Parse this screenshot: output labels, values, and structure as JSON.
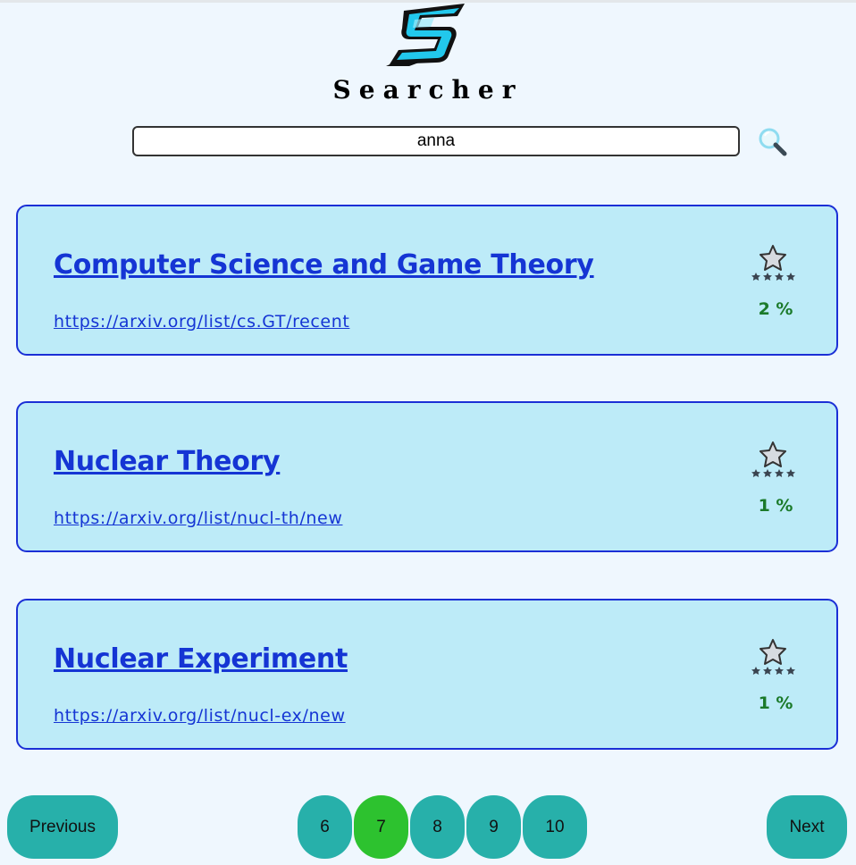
{
  "header": {
    "brand": "Searcher",
    "logo_icon": "lightning-s-logo",
    "accent_color": "#1fd0f0"
  },
  "search": {
    "value": "anna",
    "button_icon": "magnifier-icon"
  },
  "results": [
    {
      "title": "Computer Science and Game Theory",
      "url": "https://arxiv.org/list/cs.GT/recent",
      "score": "2 %"
    },
    {
      "title": "Nuclear Theory",
      "url": "https://arxiv.org/list/nucl-th/new",
      "score": "1 %"
    },
    {
      "title": "Nuclear Experiment",
      "url": "https://arxiv.org/list/nucl-ex/new",
      "score": "1 %"
    }
  ],
  "pagination": {
    "previous_label": "Previous",
    "next_label": "Next",
    "pages": [
      "6",
      "7",
      "8",
      "9",
      "10"
    ],
    "current_page": "7",
    "button_color": "#27b0aa",
    "active_color": "#2dc22f"
  }
}
